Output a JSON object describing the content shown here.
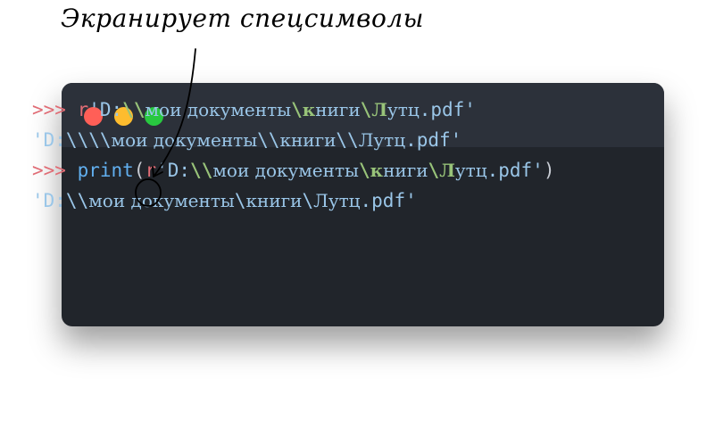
{
  "annotation": {
    "text": "Экранирует спецсимволы"
  },
  "window": {
    "controls": {
      "close_color": "#ff5f57",
      "minimize_color": "#febc2e",
      "maximize_color": "#28c840"
    }
  },
  "console": {
    "lines": [
      {
        "segments": [
          {
            "text": ">>> ",
            "kind": "prompt"
          },
          {
            "text": "r",
            "kind": "raw-prefix"
          },
          {
            "text": "'D:",
            "kind": "string"
          },
          {
            "text": "\\\\",
            "kind": "escape"
          },
          {
            "text": "мои документы",
            "kind": "string-cyrillic"
          },
          {
            "text": "\\",
            "kind": "escape"
          },
          {
            "text": "к",
            "kind": "escape-cyrillic"
          },
          {
            "text": "ниги",
            "kind": "string-cyrillic"
          },
          {
            "text": "\\",
            "kind": "escape"
          },
          {
            "text": "Л",
            "kind": "escape-cyrillic"
          },
          {
            "text": "утц",
            "kind": "string-cyrillic"
          },
          {
            "text": ".pdf'",
            "kind": "string"
          }
        ]
      },
      {
        "segments": [
          {
            "text": "'D:\\\\\\\\",
            "kind": "string"
          },
          {
            "text": "мои документы",
            "kind": "string-cyrillic"
          },
          {
            "text": "\\\\",
            "kind": "string"
          },
          {
            "text": "книги",
            "kind": "string-cyrillic"
          },
          {
            "text": "\\\\",
            "kind": "string"
          },
          {
            "text": "Лутц",
            "kind": "string-cyrillic"
          },
          {
            "text": ".pdf'",
            "kind": "string"
          }
        ]
      },
      {
        "segments": [
          {
            "text": ">>> ",
            "kind": "prompt"
          },
          {
            "text": "print",
            "kind": "function"
          },
          {
            "text": "(",
            "kind": "paren"
          },
          {
            "text": "r",
            "kind": "raw-prefix"
          },
          {
            "text": "'D:",
            "kind": "string"
          },
          {
            "text": "\\\\",
            "kind": "escape"
          },
          {
            "text": "мои документы",
            "kind": "string-cyrillic"
          },
          {
            "text": "\\",
            "kind": "escape"
          },
          {
            "text": "к",
            "kind": "escape-cyrillic"
          },
          {
            "text": "ниги",
            "kind": "string-cyrillic"
          },
          {
            "text": "\\",
            "kind": "escape"
          },
          {
            "text": "Л",
            "kind": "escape-cyrillic"
          },
          {
            "text": "утц",
            "kind": "string-cyrillic"
          },
          {
            "text": ".pdf'",
            "kind": "string"
          },
          {
            "text": ")",
            "kind": "paren"
          }
        ]
      },
      {
        "segments": [
          {
            "text": "'D:\\\\",
            "kind": "string"
          },
          {
            "text": "мои документы",
            "kind": "string-cyrillic"
          },
          {
            "text": "\\",
            "kind": "string"
          },
          {
            "text": "книги",
            "kind": "string-cyrillic"
          },
          {
            "text": "\\",
            "kind": "string"
          },
          {
            "text": "Лутц",
            "kind": "string-cyrillic"
          },
          {
            "text": ".pdf'",
            "kind": "string"
          }
        ]
      }
    ]
  }
}
